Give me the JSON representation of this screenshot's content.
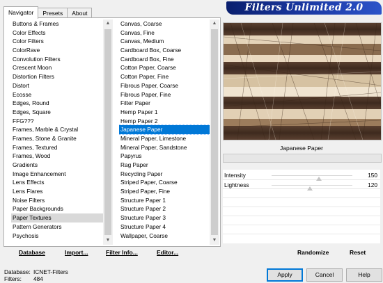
{
  "tabs": [
    "Navigator",
    "Presets",
    "About"
  ],
  "title": "Filters Unlimited 2.0",
  "categories": {
    "items": [
      "Buttons & Frames",
      "Color Effects",
      "Color Filters",
      "ColorRave",
      "Convolution Filters",
      "Crescent Moon",
      "Distortion Filters",
      "Distort",
      "Ecosse",
      "Edges, Round",
      "Edges, Square",
      "FFG???",
      "Frames, Marble & Crystal",
      "Frames, Stone & Granite",
      "Frames, Textured",
      "Frames, Wood",
      "Gradients",
      "Image Enhancement",
      "Lens Effects",
      "Lens Flares",
      "Noise Filters",
      "Paper Backgrounds",
      "Paper Textures",
      "Pattern Generators",
      "Psychosis"
    ],
    "selected": "Paper Textures"
  },
  "filters": {
    "items": [
      "Canvas, Coarse",
      "Canvas, Fine",
      "Canvas, Medium",
      "Cardboard Box, Coarse",
      "Cardboard Box, Fine",
      "Cotton Paper, Coarse",
      "Cotton Paper, Fine",
      "Fibrous Paper, Coarse",
      "Fibrous Paper, Fine",
      "Filter Paper",
      "Hemp Paper 1",
      "Hemp Paper 2",
      "Japanese Paper",
      "Mineral Paper, Limestone",
      "Mineral Paper, Sandstone",
      "Papyrus",
      "Rag Paper",
      "Recycling Paper",
      "Striped Paper, Coarse",
      "Striped Paper, Fine",
      "Structure Paper 1",
      "Structure Paper 2",
      "Structure Paper 3",
      "Structure Paper 4",
      "Wallpaper, Coarse"
    ],
    "selected": "Japanese Paper"
  },
  "left_buttons": {
    "database": "Database",
    "import": "Import...",
    "filter_info": "Filter Info...",
    "editor": "Editor..."
  },
  "current_filter": "Japanese Paper",
  "sliders": [
    {
      "label": "Intensity",
      "value": "150",
      "level": 0.59
    },
    {
      "label": "Lightness",
      "value": "120",
      "level": 0.47
    }
  ],
  "right_buttons": {
    "randomize": "Randomize",
    "reset": "Reset"
  },
  "status": {
    "database_label": "Database:",
    "database_value": "ICNET-Filters",
    "filters_label": "Filters:",
    "filters_value": "484"
  },
  "dialog_buttons": {
    "apply": "Apply",
    "cancel": "Cancel",
    "help": "Help"
  },
  "colors": {
    "selection": "#0078d7",
    "title_bg": "#1c3aa6"
  }
}
